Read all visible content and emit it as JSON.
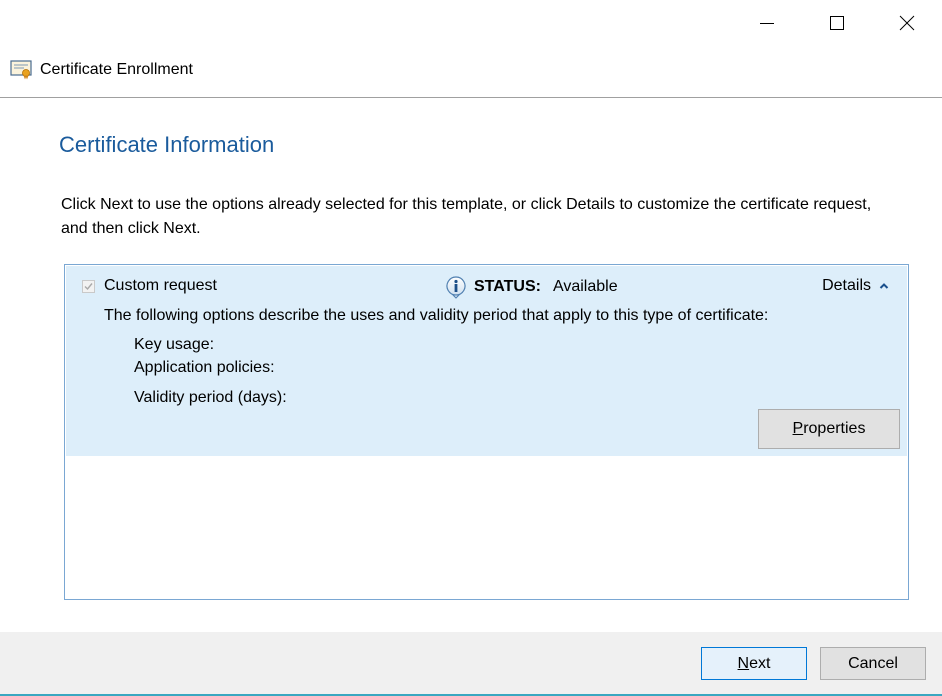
{
  "window": {
    "title": "Certificate Enrollment",
    "controls": [
      "minimize-icon",
      "maximize-icon",
      "close-icon"
    ]
  },
  "page": {
    "title": "Certificate Information",
    "description": "Click Next to use the options already selected for this template, or click Details to customize the certificate request, and then click Next."
  },
  "enrollment_item": {
    "checked": true,
    "enabled": false,
    "name": "Custom request",
    "status_icon": "info-icon",
    "status_label": "STATUS:",
    "status_value": "Available",
    "details_label": "Details",
    "details_icon": "chevron-up-icon",
    "options_description": "The following options describe the uses and validity period that apply to this type of certificate:",
    "key_usage_label": "Key usage:",
    "application_policies_label": "Application policies:",
    "validity_period_label": "Validity period (days):",
    "properties_button": "Properties"
  },
  "footer": {
    "next_button": "Next",
    "cancel_button": "Cancel"
  },
  "colors": {
    "title_blue": "#1a5b9c",
    "selected_item_bg": "#ddeefa",
    "panel_border": "#7aa7d3",
    "default_button_border": "#0078d7",
    "footer_bg": "#f0f0f0"
  }
}
